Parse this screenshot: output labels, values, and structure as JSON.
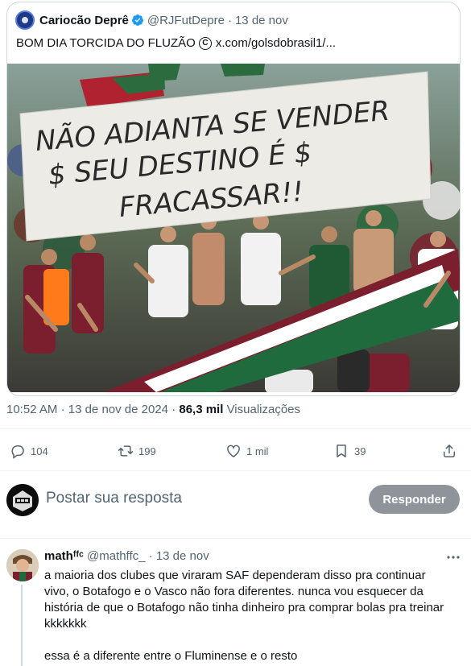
{
  "quoted_tweet": {
    "author_name": "Cariocão Deprê",
    "author_handle": "@RJFutDepre",
    "separator": "·",
    "date": "13 de nov",
    "text_before": "BOM DIA TORCIDA DO FLUZÃO",
    "link": "x.com/golsdobrasil1/...",
    "banner_line1": "NÃO ADIANTA SE VENDER",
    "banner_line2": "$ SEU DESTINO É $",
    "banner_line3": "FRACASSAR!!"
  },
  "tweet_meta": {
    "time": "10:52 AM",
    "separator": "·",
    "date": "13 de nov de 2024",
    "views_count": "86,3 mil",
    "views_label": "Visualizações"
  },
  "actions": {
    "replies": "104",
    "retweets": "199",
    "likes": "1 mil",
    "bookmarks": "39"
  },
  "composer": {
    "placeholder": "Postar sua resposta",
    "button_label": "Responder"
  },
  "reply": {
    "author_name": "mathᶠᶠᶜ",
    "author_handle": "@mathffc_",
    "separator": "·",
    "date": "13 de nov",
    "line1": "a maioria dos clubes que viraram SAF dependeram disso pra continuar",
    "line2": "vivo, o Botafogo e o Vasco não fora diferentes. nunca vou esquecer da",
    "line3": "história de que o Botafogo não tinha dinheiro pra comprar bolas pra treinar",
    "line4": "kkkkkkk",
    "line5": "essa é a diferente entre o Fluminense e o resto"
  },
  "colors": {
    "brand_blue": "#1d9bf0",
    "text_secondary": "#536471",
    "button_disabled": "#8e9499"
  }
}
